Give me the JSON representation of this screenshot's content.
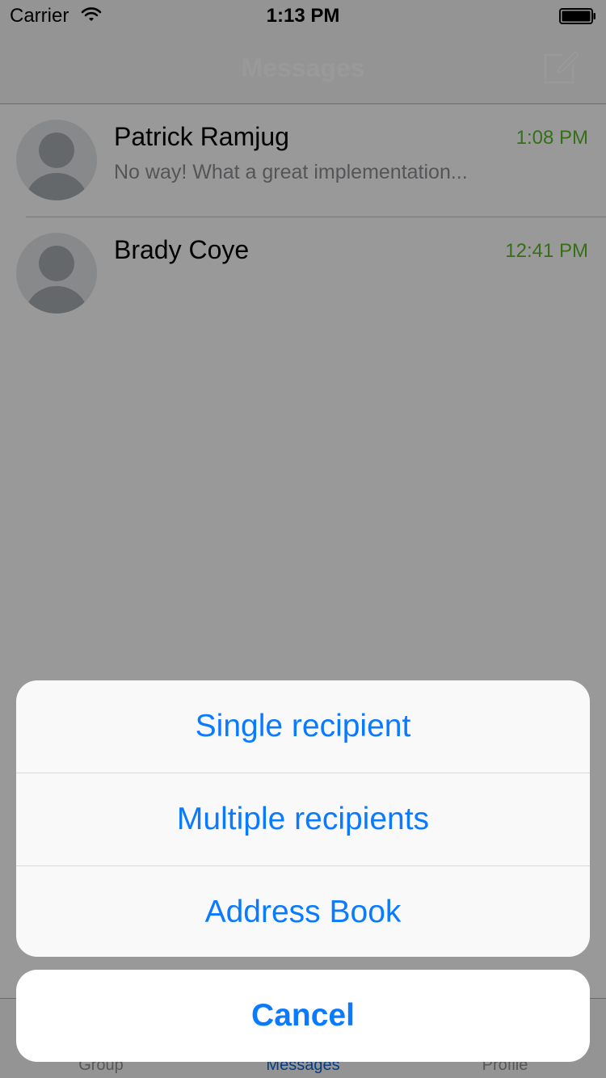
{
  "status_bar": {
    "carrier": "Carrier",
    "time": "1:13 PM",
    "wifi_icon": "wifi-icon",
    "battery_icon": "battery-icon"
  },
  "nav_bar": {
    "title": "Messages",
    "compose_icon": "compose-icon"
  },
  "messages": [
    {
      "name": "Patrick Ramjug",
      "time": "1:08 PM",
      "preview": "No way! What a great implementation..."
    },
    {
      "name": "Brady Coye",
      "time": "12:41 PM",
      "preview": ""
    }
  ],
  "tab_bar": {
    "items": [
      {
        "label": "Group"
      },
      {
        "label": "Messages"
      },
      {
        "label": "Profile"
      }
    ],
    "active": "Messages"
  },
  "action_sheet": {
    "options": [
      {
        "label": "Single recipient"
      },
      {
        "label": "Multiple recipients"
      },
      {
        "label": "Address Book"
      }
    ],
    "cancel_label": "Cancel"
  },
  "colors": {
    "accent": "#0a7aff",
    "time_green": "#5cb82a",
    "tab_active": "#0a64d8"
  }
}
